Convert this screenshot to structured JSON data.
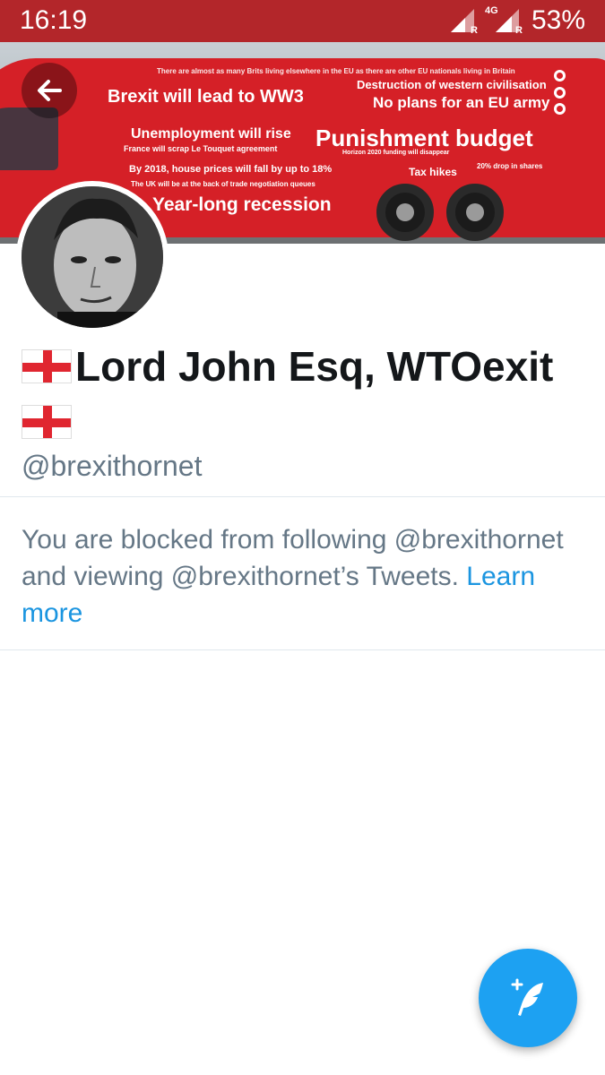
{
  "status_bar": {
    "time": "16:19",
    "network_type": "4G",
    "roaming_label": "R",
    "battery": "53%",
    "background_color": "#b3262a"
  },
  "header": {
    "back_icon": "arrow-left-icon",
    "more_icon": "more-vertical-icon",
    "banner_texts": {
      "line_small_top": "There are almost as many Brits living elsewhere in the EU as there are other EU nationals living in Britain",
      "line_ww3": "Brexit will lead to WW3",
      "line_destruction": "Destruction of western civilisation",
      "line_army": "No plans for an EU army",
      "line_unemployment": "Unemployment will rise",
      "line_touquet": "France will scrap Le Touquet agreement",
      "line_punishment": "Punishment budget",
      "line_horizon": "Horizon 2020 funding will disappear",
      "line_house": "By 2018, house prices will fall by up to 18%",
      "line_tax": "Tax hikes",
      "line_shares": "20% drop in shares",
      "line_queue": "The UK will be at the back of trade negotiation queues",
      "line_recession": "Year-long recession"
    }
  },
  "profile": {
    "flag_icon": "england-flag-icon",
    "name": "Lord John Esq, WTOexit",
    "handle": "@brexithornet"
  },
  "blocked_notice": {
    "text": "You are blocked from following @brexithornet and viewing @brexithornet’s Tweets.",
    "link_label": "Learn more",
    "link_color": "#1b95e0"
  },
  "fab": {
    "icon": "compose-tweet-icon",
    "color": "#1da1f2"
  }
}
